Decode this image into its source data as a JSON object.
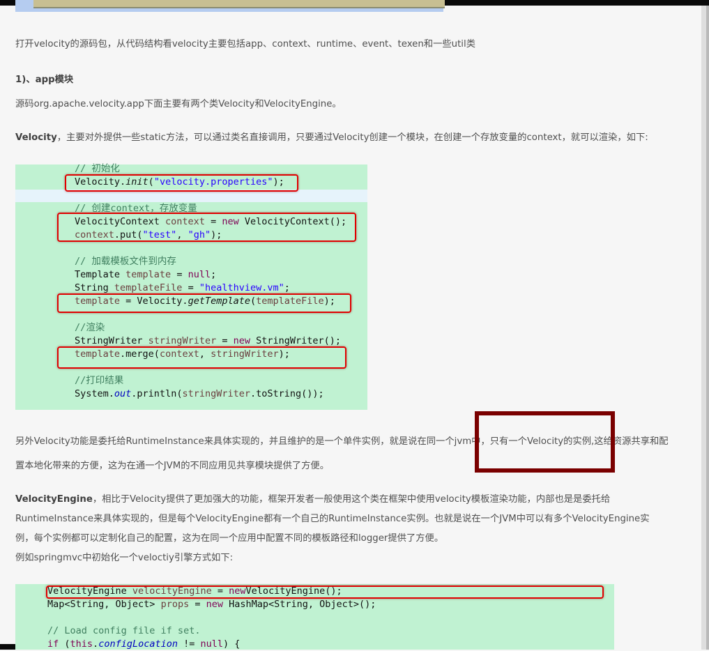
{
  "intro": "打开velocity的源码包，从代码结构看velocity主要包括app、context、runtime、event、texen和一些util类",
  "app_heading": "1)、app模块",
  "app_desc": "源码org.apache.velocity.app下面主要有两个类Velocity和VelocityEngine。",
  "velocity": {
    "term": "Velocity",
    "desc": "，主要对外提供一些static方法，可以通过类名直接调用，只要通过Velocity创建一个模块，在创建一个存放变量的context，就可以渲染，如下:"
  },
  "code1": {
    "c1": "// 初始化",
    "l1a": "Velocity.",
    "l1b": "init",
    "l1c": "(",
    "l1d": "\"velocity.properties\"",
    "l1e": ");",
    "c2": "// 创建context，存放变量",
    "l2a": "VelocityContext ",
    "l2b": "context",
    "l2c": " = ",
    "l2d": "new",
    "l2e": " VelocityContext();",
    "l3a": "context",
    "l3b": ".put(",
    "l3c": "\"test\"",
    "l3d": ", ",
    "l3e": "\"gh\"",
    "l3f": ");",
    "c3": "// 加载模板文件到内存",
    "l4a": "Template ",
    "l4b": "template",
    "l4c": " = ",
    "l4d": "null",
    "l4e": ";",
    "l5a": "String ",
    "l5b": "templateFile",
    "l5c": " = ",
    "l5d": "\"healthview.vm\"",
    "l5e": ";",
    "l6a": "template",
    "l6b": " = Velocity.",
    "l6c": "getTemplate",
    "l6d": "(",
    "l6e": "templateFile",
    "l6f": ");",
    "c4": "//渲染",
    "l7a": "StringWriter ",
    "l7b": "stringWriter",
    "l7c": " = ",
    "l7d": "new",
    "l7e": " StringWriter();",
    "l8a": "template",
    "l8b": ".merge(",
    "l8c": "context",
    "l8d": ", ",
    "l8e": "stringWriter",
    "l8f": ");",
    "c5": "//打印结果",
    "l9a": "System.",
    "l9b": "out",
    "l9c": ".println(",
    "l9d": "stringWriter",
    "l9e": ".toString());"
  },
  "runtime_para": {
    "line1": "另外Velocity功能是委托给RuntimeInstance来具体实现的，并且维护的是一个单件实例，就是说在同一个jvm中，只有一个Velocity的实例,这给资源共享和配",
    "line2": "置本地化带来的方便，这为在通一个JVM的不同应用见共享模块提供了方便。"
  },
  "engine": {
    "term": "VelocityEngine",
    "line1": "，相比于Velocity提供了更加强大的功能，框架开发者一般使用这个类在框架中使用velocity模板渲染功能，内部也是是委托给",
    "line2": "RuntimeInstance来具体实现的，但是每个VelocityEngine都有一个自己的RuntimeInstance实例。也就是说在一个JVM中可以有多个VelocityEngine实",
    "line3": "例，每个实例都可以定制化自己的配置，这为在同一个应用中配置不同的模板路径和logger提供了方便。",
    "line4": "例如springmvc中初始化一个veloctiy引擎方式如下:"
  },
  "code2": {
    "l1a": "VelocityEngine ",
    "l1b": "velocityEngine",
    "l1c": " = ",
    "l1d": "new",
    "l1e": "VelocityEngine();",
    "l2a": "Map<String, Object> ",
    "l2b": "props",
    "l2c": " = ",
    "l2d": "new",
    "l2e": " HashMap<String, Object>();",
    "c1": "// Load config file if set.",
    "l3a": "if",
    "l3b": " (",
    "l3c": "this",
    "l3d": ".",
    "l3e": "configLocation",
    "l3f": " != ",
    "l3g": "null",
    "l3h": ") {"
  },
  "colors": {
    "code_bg": "#c0f2d2",
    "highlight_box": "#e00000",
    "annotation_box": "#7a0000",
    "comment": "#3f7f5f",
    "keyword": "#7f0055",
    "string": "#2a00ff"
  }
}
